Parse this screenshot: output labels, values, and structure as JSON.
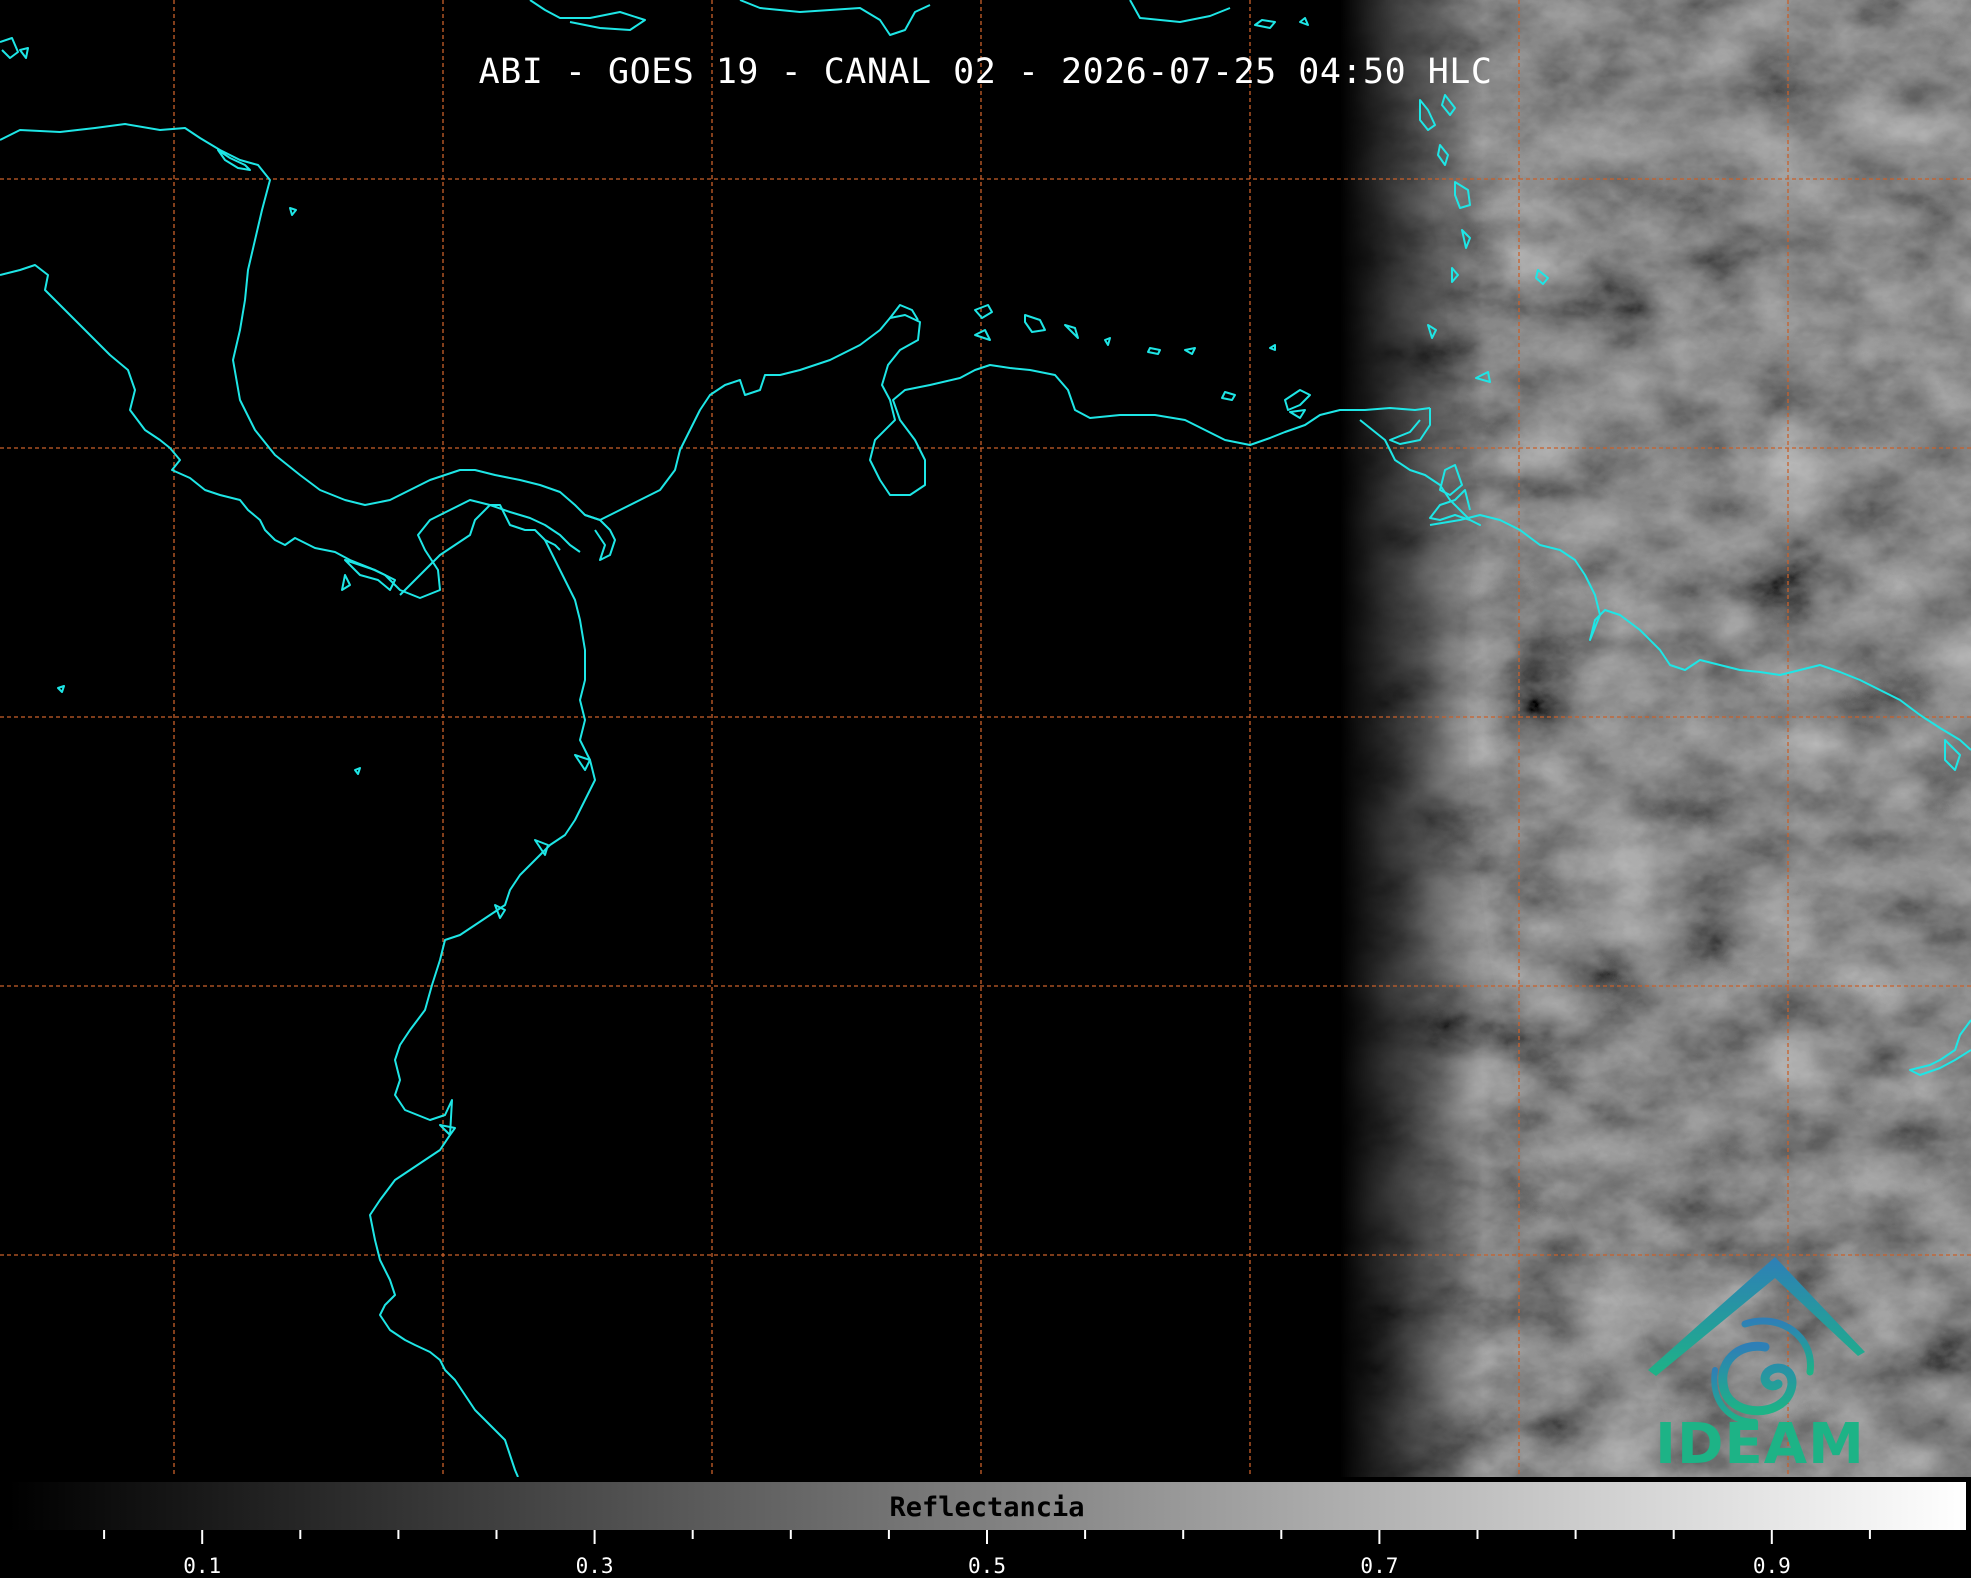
{
  "title": "ABI - GOES 19 - CANAL 02 - 2026-07-25 04:50 HLC",
  "colorbar": {
    "label": "Reflectancia",
    "range": [
      0,
      1
    ],
    "gradient": [
      "#000000",
      "#ffffff"
    ],
    "major_ticks": [
      "0.1",
      "0.3",
      "0.5",
      "0.7",
      "0.9"
    ],
    "major_values": [
      0.1,
      0.3,
      0.5,
      0.7,
      0.9
    ],
    "minor_values": [
      0.05,
      0.15,
      0.2,
      0.25,
      0.35,
      0.4,
      0.45,
      0.55,
      0.6,
      0.65,
      0.75,
      0.8,
      0.85,
      0.95
    ]
  },
  "logo": {
    "text": "IDEAM",
    "color_top": "#2e7fb7",
    "color_bottom": "#1db386"
  },
  "colors": {
    "coastline": "#1ee6e6",
    "gridlines": "#c9602a",
    "background": "#000000"
  }
}
